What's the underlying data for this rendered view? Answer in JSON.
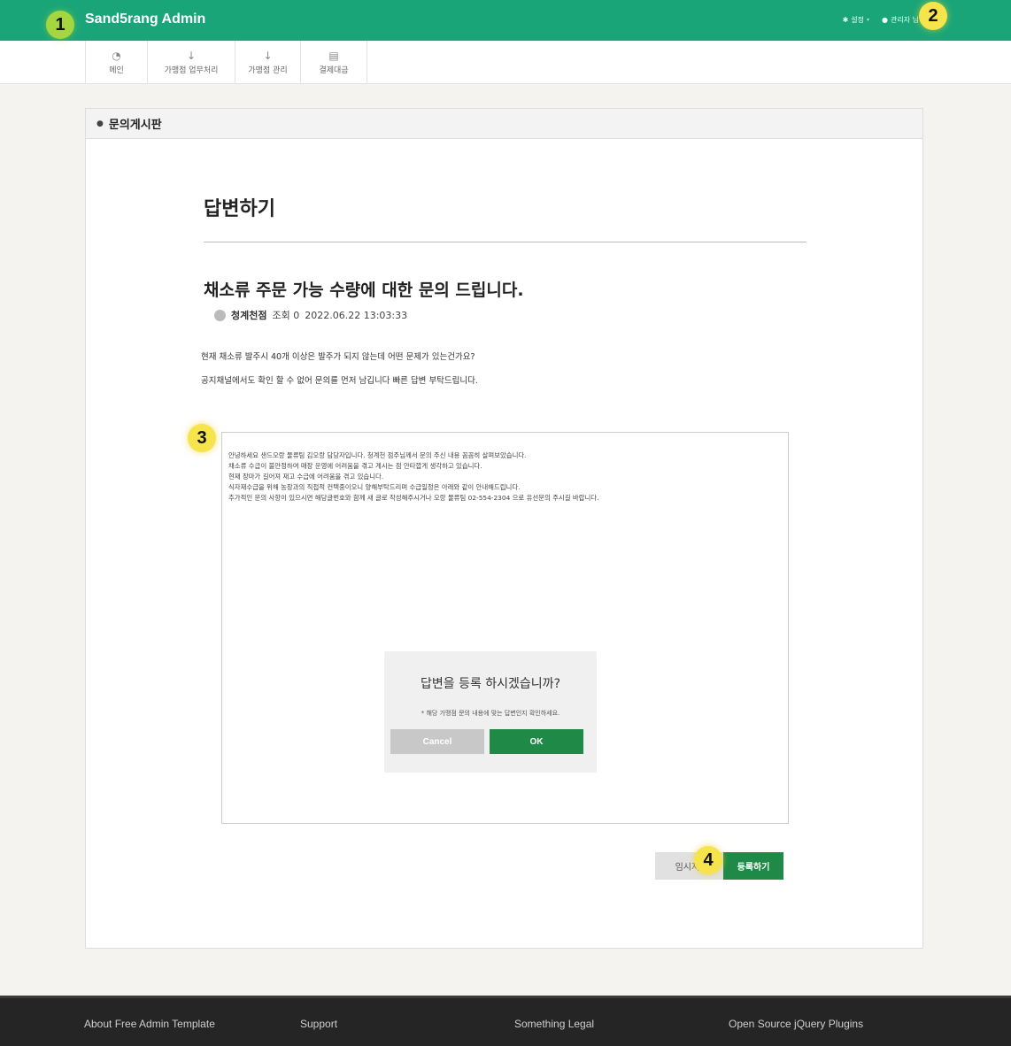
{
  "app": {
    "brand": "Sand5rang Admin"
  },
  "top_nav": [
    {
      "icon": "gear-icon",
      "label": "설정"
    },
    {
      "icon": "user-icon",
      "label": "관리자 님"
    }
  ],
  "markers": [
    "1",
    "2",
    "3",
    "4"
  ],
  "sub_nav": [
    {
      "icon": "dashboard-icon",
      "label": "메인"
    },
    {
      "icon": "arrow-down-icon",
      "label": "가맹점 업무처리"
    },
    {
      "icon": "arrow-down-icon",
      "label": "가맹점 관리"
    },
    {
      "icon": "calendar-icon",
      "label": "결제대금"
    }
  ],
  "panel": {
    "icon": "user-icon",
    "title": "문의게시판"
  },
  "page": {
    "title": "답변하기"
  },
  "post": {
    "title": "채소류 주문 가능 수량에 대한 문의 드립니다.",
    "author": "청계천점",
    "views": "조회 0",
    "date": "2022.06.22 13:03:33",
    "body": [
      "현재 채소류 발주시 40개 이상은 발주가 되지 않는데 어떤 문제가 있는건가요?",
      "공지채널에서도 확인 할 수 없어 문의를 먼저 남깁니다 빠른 답변 부탁드립니다."
    ]
  },
  "editor": {
    "lines": [
      "안녕하세요 샌드오랑 물류팀 김오랑 담당자입니다. 청계천 점주님께서 문의 주신 내용 꼼꼼히 살펴보았습니다.",
      "채소류 수급이 불안정하여 매장 운영에 어려움을 겪고 계시는 점 안타깝게 생각하고 있습니다.",
      "현재 장마가 길어져 재고 수급에 어려움을 겪고 있습니다.",
      "식자재수급을 위해 농장과의 직접적 컨택중이오니 양해부탁드리며 수급일정은 아래와 같이 안내해드립니다.",
      "추가적인 문의 사항이 있으시면 해당글번호와 함께 새 글로 작성해주시거나 오랑 물류팀 02-554-2304 으로 유선문의 주시길 바랍니다."
    ]
  },
  "dialog": {
    "title": "답변을 등록 하시겠습니까?",
    "note": "* 해당 가맹점 문의 내용에 맞는 답변인지 확인하세요.",
    "cancel_label": "Cancel",
    "ok_label": "OK"
  },
  "actions": {
    "draft_label": "임시저장",
    "submit_label": "등록하기"
  },
  "footer": {
    "links": [
      "About Free Admin Template",
      "Support",
      "Something Legal",
      "Open Source jQuery Plugins"
    ]
  },
  "colors": {
    "brand": "#1aa578",
    "ok": "#1f8a47",
    "footer": "#252525"
  }
}
